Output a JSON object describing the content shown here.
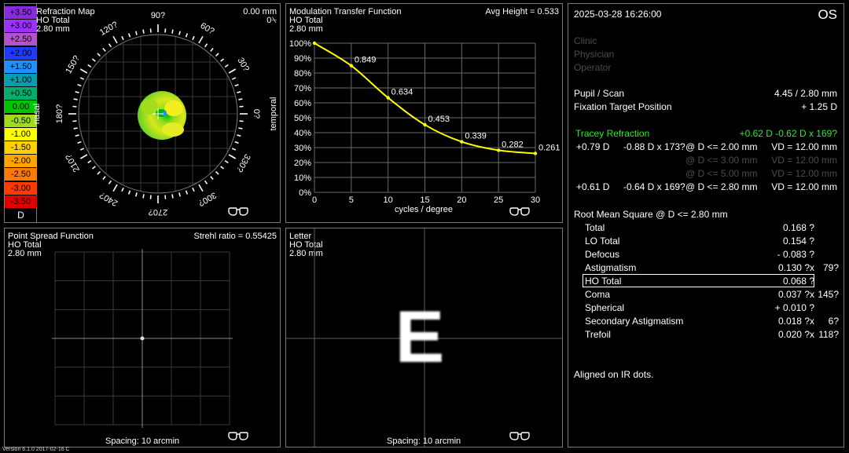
{
  "refraction_map": {
    "title": "Refraction Map",
    "subtitle": "HO Total",
    "size": "2.80 mm",
    "offset": "0.00 mm",
    "offset_angle": "0⍀",
    "nasal_label": "nasal",
    "temporal_label": "temporal",
    "angle_labels": [
      "0?",
      "30?",
      "60?",
      "90?",
      "120?",
      "150?",
      "180?",
      "210?",
      "240?",
      "270?",
      "300?",
      "330?"
    ],
    "scale_unit": "D",
    "scale": [
      {
        "label": "+3.50",
        "color": "#8a2be2",
        "text_color": "#000000"
      },
      {
        "label": "+3.00",
        "color": "#9b30ff",
        "text_color": "#000000"
      },
      {
        "label": "+2.50",
        "color": "#b452cd",
        "text_color": "#000000"
      },
      {
        "label": "+2.00",
        "color": "#1e3cff",
        "text_color": "#000000"
      },
      {
        "label": "+1.50",
        "color": "#1e90ff",
        "text_color": "#000000"
      },
      {
        "label": "+1.00",
        "color": "#00a0b0",
        "text_color": "#000000"
      },
      {
        "label": "+0.50",
        "color": "#00b06a",
        "text_color": "#000000"
      },
      {
        "label": "0.00",
        "color": "#00c400",
        "text_color": "#000000"
      },
      {
        "label": "-0.50",
        "color": "#9fdc1c",
        "text_color": "#000000"
      },
      {
        "label": "-1.00",
        "color": "#ffff00",
        "text_color": "#000000"
      },
      {
        "label": "-1.50",
        "color": "#ffd000",
        "text_color": "#000000"
      },
      {
        "label": "-2.00",
        "color": "#ffa500",
        "text_color": "#000000"
      },
      {
        "label": "-2.50",
        "color": "#ff7a00",
        "text_color": "#000000"
      },
      {
        "label": "-3.00",
        "color": "#ff3a00",
        "text_color": "#000000"
      },
      {
        "label": "-3.50",
        "color": "#e00000",
        "text_color": "#000000"
      }
    ]
  },
  "mtf": {
    "title": "Modulation Transfer Function",
    "subtitle": "HO Total",
    "size": "2.80 mm",
    "avg_height": "Avg Height = 0.533",
    "xlabel": "cycles / degree",
    "line_color": "#ffff00"
  },
  "chart_data": {
    "type": "line",
    "title": "Modulation Transfer Function",
    "xlabel": "cycles / degree",
    "ylabel": "",
    "x": [
      0,
      5,
      10,
      15,
      20,
      25,
      30
    ],
    "series": [
      {
        "values": [
          1.0,
          0.849,
          0.634,
          0.453,
          0.339,
          0.282,
          0.261
        ]
      }
    ],
    "data_labels": [
      "",
      "0.849",
      "0.634",
      "0.453",
      "0.339",
      "0.282",
      "0.261"
    ],
    "xlim": [
      0,
      30
    ],
    "ylim": [
      0,
      1
    ],
    "xticks": [
      "0",
      "5",
      "10",
      "15",
      "20",
      "25",
      "30"
    ],
    "yticks": [
      "0%",
      "10%",
      "20%",
      "30%",
      "40%",
      "50%",
      "60%",
      "70%",
      "80%",
      "90%",
      "100%"
    ],
    "grid": true
  },
  "psf": {
    "title": "Point Spread Function",
    "subtitle": "HO Total",
    "size": "2.80 mm",
    "strehl": "Strehl ratio = 0.55425",
    "spacing": "Spacing:  10 arcmin"
  },
  "letter": {
    "title": "Letter",
    "subtitle": "HO Total",
    "size": "2.80 mm",
    "glyph": "E",
    "spacing": "Spacing:  10 arcmin"
  },
  "info": {
    "datetime": "2025-03-28   16:26:00",
    "eye": "OS",
    "clinic": "Clinic",
    "physician": "Physician",
    "operator": "Operator",
    "pupil_label": "Pupil / Scan",
    "pupil_value": "4.45 / 2.80 mm",
    "fixation_label": "Fixation Target Position",
    "fixation_value": "+ 1.25 D",
    "tracey_label": "Tracey Refraction",
    "tracey_value": "+0.62 D -0.62 D x 169?",
    "refractions": [
      {
        "sph": "+0.79 D",
        "cyl": "-0.88 D x 173?",
        "zone": "@ D <= 2.00 mm",
        "vd": "VD = 12.00 mm",
        "dim": false
      },
      {
        "sph": "",
        "cyl": "",
        "zone": "@ D <= 3.00 mm",
        "vd": "VD = 12.00 mm",
        "dim": true
      },
      {
        "sph": "",
        "cyl": "",
        "zone": "@ D <= 5.00 mm",
        "vd": "VD = 12.00 mm",
        "dim": true
      },
      {
        "sph": "+0.61 D",
        "cyl": "-0.64 D x 169?",
        "zone": "@ D <= 2.80 mm",
        "vd": "VD = 12.00 mm",
        "dim": false
      }
    ],
    "rms_title": "Root Mean Square @ D <= 2.80 mm",
    "rms": [
      {
        "label": "Total",
        "value": "0.168 ?",
        "axis": ""
      },
      {
        "label": "LO Total",
        "value": "0.154 ?",
        "axis": ""
      },
      {
        "label": "Defocus",
        "value": "- 0.083 ?",
        "axis": ""
      },
      {
        "label": "Astigmatism",
        "value": "0.130 ?x",
        "axis": "79?"
      },
      {
        "label": "HO Total",
        "value": "0.068 ?",
        "axis": ""
      },
      {
        "label": "Coma",
        "value": "0.037 ?x",
        "axis": "145?"
      },
      {
        "label": "Spherical",
        "value": "+ 0.010 ?",
        "axis": ""
      },
      {
        "label": "Secondary Astigmatism",
        "value": "0.018 ?x",
        "axis": "6?"
      },
      {
        "label": "Trefoil",
        "value": "0.020 ?x",
        "axis": "118?"
      }
    ],
    "rms_selected": "HO Total",
    "note": "Aligned on IR dots."
  },
  "version": "Version 6.1.0 2017-02-16 C"
}
